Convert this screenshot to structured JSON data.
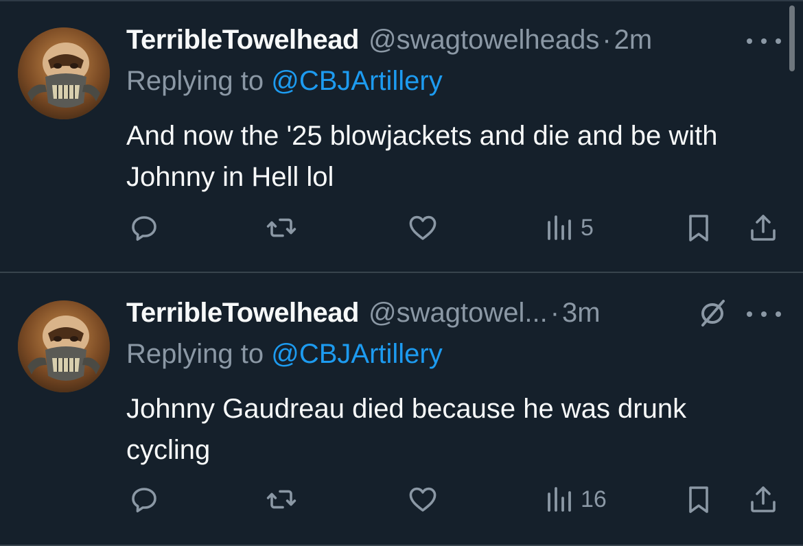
{
  "colors": {
    "background": "#15202b",
    "text_primary": "#f7f9f9",
    "text_secondary": "#8b98a5",
    "accent": "#1d9bf0",
    "divider": "#38444d"
  },
  "tweets": [
    {
      "display_name": "TerribleTowelhead",
      "handle": "@swagtowelheads",
      "separator": "·",
      "time": "2m",
      "replying_prefix": "Replying to ",
      "replying_to": "@CBJArtillery",
      "text": "And now the '25 blowjackets and die and be with Johnny in Hell lol",
      "views": "5",
      "icons": {
        "avatar": "avatar-masked-face",
        "reply": "reply-icon",
        "retweet": "retweet-icon",
        "like": "heart-icon",
        "views": "views-bar-chart-icon",
        "bookmark": "bookmark-icon",
        "share": "share-icon",
        "more": "more-icon"
      }
    },
    {
      "display_name": "TerribleTowelhead",
      "handle": "@swagtowel...",
      "separator": "·",
      "time": "3m",
      "replying_prefix": "Replying to ",
      "replying_to": "@CBJArtillery",
      "text": "Johnny Gaudreau died because he was drunk cycling",
      "views": "16",
      "icons": {
        "avatar": "avatar-masked-face",
        "grok": "grok-slash-icon",
        "reply": "reply-icon",
        "retweet": "retweet-icon",
        "like": "heart-icon",
        "views": "views-bar-chart-icon",
        "bookmark": "bookmark-icon",
        "share": "share-icon",
        "more": "more-icon"
      }
    }
  ]
}
